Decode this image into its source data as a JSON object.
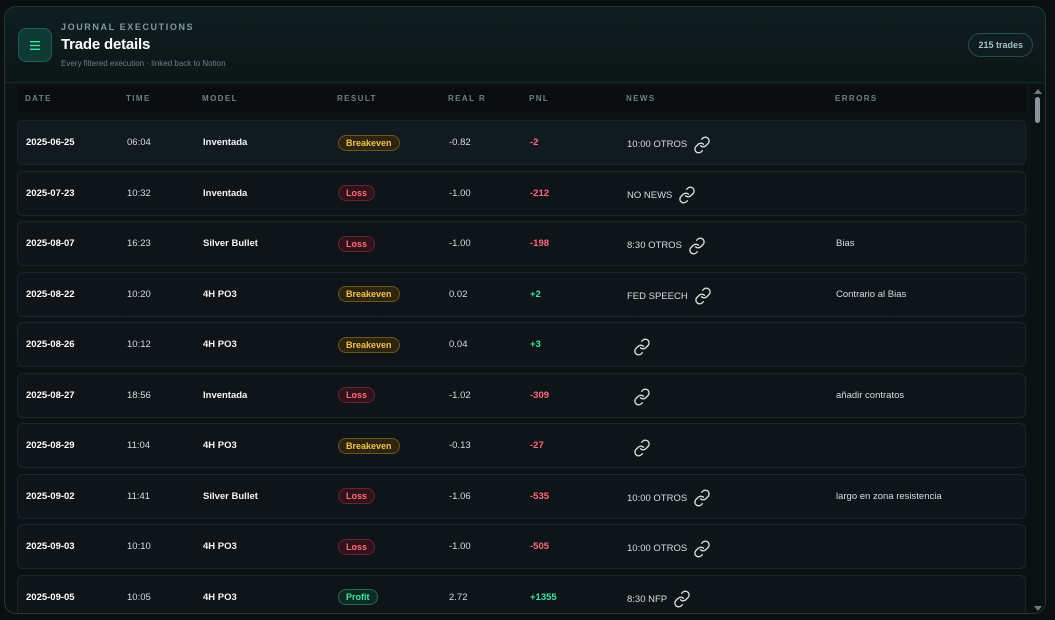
{
  "header": {
    "eyebrow": "JOURNAL EXECUTIONS",
    "title": "Trade details",
    "subtitle": "Every filtered execution · linked back to Notion",
    "count": "215 trades",
    "menu_icon": "menu-icon"
  },
  "columns": {
    "date": "DATE",
    "time": "TIME",
    "model": "MODEL",
    "result": "RESULT",
    "real_r": "REAL R",
    "pnl": "PNL",
    "news": "NEWS",
    "errors": "ERRORS"
  },
  "colors": {
    "breakeven": "#f2c14e",
    "loss": "#ff6b7a",
    "profit": "#3ee6a0",
    "accent": "#1f5d52"
  },
  "rows": [
    {
      "date": "2025-06-25",
      "time": "06:04",
      "model": "Inventada",
      "result": "Breakeven",
      "real_r": "-0.82",
      "pnl": "-2",
      "news": "10:00 OTROS",
      "errors": ""
    },
    {
      "date": "2025-07-23",
      "time": "10:32",
      "model": "Inventada",
      "result": "Loss",
      "real_r": "-1.00",
      "pnl": "-212",
      "news": "NO NEWS",
      "errors": ""
    },
    {
      "date": "2025-08-07",
      "time": "16:23",
      "model": "Silver Bullet",
      "result": "Loss",
      "real_r": "-1.00",
      "pnl": "-198",
      "news": "8:30 OTROS",
      "errors": "Bias"
    },
    {
      "date": "2025-08-22",
      "time": "10:20",
      "model": "4H PO3",
      "result": "Breakeven",
      "real_r": "0.02",
      "pnl": "+2",
      "news": "FED SPEECH",
      "errors": "Contrario al Bias"
    },
    {
      "date": "2025-08-26",
      "time": "10:12",
      "model": "4H PO3",
      "result": "Breakeven",
      "real_r": "0.04",
      "pnl": "+3",
      "news": "",
      "errors": ""
    },
    {
      "date": "2025-08-27",
      "time": "18:56",
      "model": "Inventada",
      "result": "Loss",
      "real_r": "-1.02",
      "pnl": "-309",
      "news": "",
      "errors": "añadir contratos"
    },
    {
      "date": "2025-08-29",
      "time": "11:04",
      "model": "4H PO3",
      "result": "Breakeven",
      "real_r": "-0.13",
      "pnl": "-27",
      "news": "",
      "errors": ""
    },
    {
      "date": "2025-09-02",
      "time": "11:41",
      "model": "Silver Bullet",
      "result": "Loss",
      "real_r": "-1.06",
      "pnl": "-535",
      "news": "10:00 OTROS",
      "errors": "largo en zona resistencia"
    },
    {
      "date": "2025-09-03",
      "time": "10:10",
      "model": "4H PO3",
      "result": "Loss",
      "real_r": "-1.00",
      "pnl": "-505",
      "news": "10:00 OTROS",
      "errors": ""
    },
    {
      "date": "2025-09-05",
      "time": "10:05",
      "model": "4H PO3",
      "result": "Profit",
      "real_r": "2.72",
      "pnl": "+1355",
      "news": "8:30 NFP",
      "errors": ""
    }
  ]
}
